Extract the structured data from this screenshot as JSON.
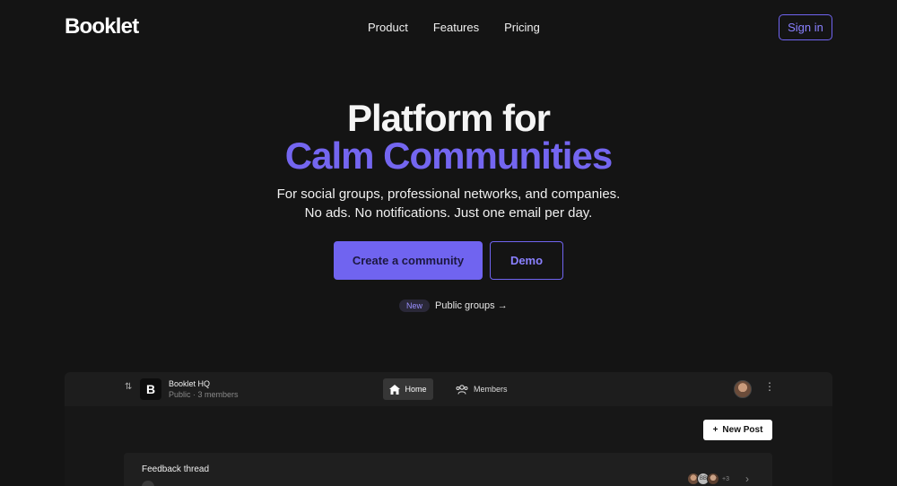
{
  "brand": "Booklet",
  "nav": {
    "items": [
      {
        "label": "Product"
      },
      {
        "label": "Features"
      },
      {
        "label": "Pricing"
      }
    ],
    "sign_in": "Sign in"
  },
  "hero": {
    "title_line1": "Platform for",
    "title_line2": "Calm Communities",
    "subtitle_line1": "For social groups, professional networks, and companies.",
    "subtitle_line2": "No ads. No notifications. Just one email per day.",
    "cta_primary": "Create a community",
    "cta_secondary": "Demo",
    "announcement_badge": "New",
    "announcement_text": "Public groups →"
  },
  "preview": {
    "community_initial": "B",
    "community_name": "Booklet HQ",
    "community_sub": "Public · 3 members",
    "tabs": {
      "home": "Home",
      "members": "Members"
    },
    "new_post": "New Post",
    "thread_title": "Feedback thread",
    "avatar_stack_middle": "BB",
    "avatar_stack_more": "+3"
  },
  "colors": {
    "background": "#141414",
    "accent": "#7064f0"
  }
}
